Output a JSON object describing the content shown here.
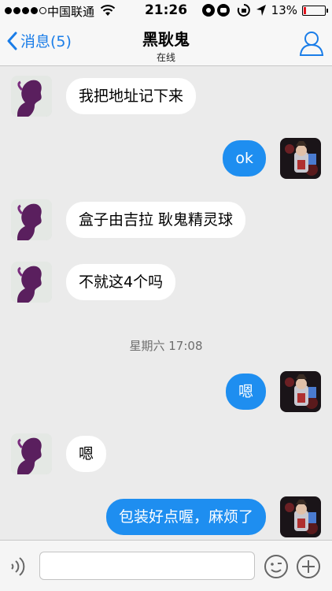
{
  "status_bar": {
    "carrier": "中国联通",
    "time": "21:26",
    "battery": "13%",
    "battery_level": 0.13
  },
  "nav": {
    "back_label": "消息(5)",
    "title": "黑耿鬼",
    "subtitle": "在线"
  },
  "messages": [
    {
      "side": "in",
      "text": "我把地址记下来"
    },
    {
      "side": "out",
      "text": "ok"
    },
    {
      "side": "in",
      "text": "盒子由吉拉 耿鬼精灵球"
    },
    {
      "side": "in",
      "text": "不就这4个吗"
    },
    {
      "side": "out",
      "text": "嗯"
    },
    {
      "side": "in",
      "text": "嗯"
    },
    {
      "side": "out",
      "text": "包装好点喔，麻烦了"
    }
  ],
  "timestamp": "星期六 17:08",
  "input": {
    "placeholder": "",
    "value": ""
  },
  "colors": {
    "accent": "#1a7de8",
    "outgoing_bubble": "#1e8ef0",
    "incoming_bubble": "#ffffff",
    "background": "#ebebeb"
  }
}
